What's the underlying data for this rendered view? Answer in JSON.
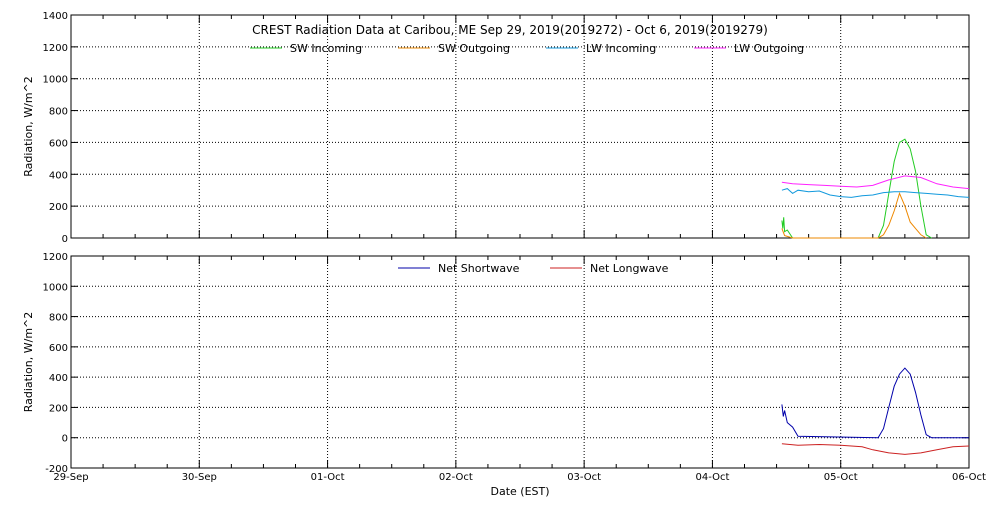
{
  "chart_data": [
    {
      "type": "line",
      "title": "CREST Radiation Data at Caribou, ME   Sep 29, 2019(2019272) - Oct  6, 2019(2019279)",
      "xlabel": "",
      "ylabel": "Radiation, W/m^2",
      "xlim": [
        "2019-09-29T00:00",
        "2019-10-06T00:00"
      ],
      "ylim": [
        0,
        1400
      ],
      "yticks": [
        0,
        200,
        400,
        600,
        800,
        1000,
        1200,
        1400
      ],
      "grid": true,
      "legend_position": "top",
      "series": [
        {
          "name": "SW Incoming",
          "color": "#22cc22",
          "points": [
            [
              "2019-10-04T13:00",
              110
            ],
            [
              "2019-10-04T13:10",
              60
            ],
            [
              "2019-10-04T13:20",
              130
            ],
            [
              "2019-10-04T13:30",
              40
            ],
            [
              "2019-10-04T14:00",
              50
            ],
            [
              "2019-10-04T15:00",
              0
            ],
            [
              "2019-10-05T07:00",
              0
            ],
            [
              "2019-10-05T08:00",
              80
            ],
            [
              "2019-10-05T09:00",
              280
            ],
            [
              "2019-10-05T10:00",
              480
            ],
            [
              "2019-10-05T11:00",
              600
            ],
            [
              "2019-10-05T12:00",
              620
            ],
            [
              "2019-10-05T13:00",
              560
            ],
            [
              "2019-10-05T14:00",
              420
            ],
            [
              "2019-10-05T15:00",
              200
            ],
            [
              "2019-10-05T16:00",
              20
            ],
            [
              "2019-10-05T17:00",
              0
            ]
          ]
        },
        {
          "name": "SW Outgoing",
          "color": "#ee8800",
          "points": [
            [
              "2019-10-04T13:00",
              60
            ],
            [
              "2019-10-04T13:30",
              15
            ],
            [
              "2019-10-04T14:00",
              10
            ],
            [
              "2019-10-04T15:00",
              0
            ],
            [
              "2019-10-05T07:00",
              0
            ],
            [
              "2019-10-05T08:00",
              20
            ],
            [
              "2019-10-05T09:00",
              80
            ],
            [
              "2019-10-05T10:00",
              170
            ],
            [
              "2019-10-05T11:00",
              280
            ],
            [
              "2019-10-05T12:00",
              200
            ],
            [
              "2019-10-05T13:00",
              100
            ],
            [
              "2019-10-05T14:00",
              60
            ],
            [
              "2019-10-05T15:00",
              20
            ],
            [
              "2019-10-05T16:00",
              0
            ]
          ]
        },
        {
          "name": "LW Incoming",
          "color": "#1199dd",
          "points": [
            [
              "2019-10-04T13:00",
              300
            ],
            [
              "2019-10-04T14:00",
              310
            ],
            [
              "2019-10-04T15:00",
              280
            ],
            [
              "2019-10-04T16:00",
              300
            ],
            [
              "2019-10-04T18:00",
              290
            ],
            [
              "2019-10-04T20:00",
              295
            ],
            [
              "2019-10-04T22:00",
              270
            ],
            [
              "2019-10-05T00:00",
              260
            ],
            [
              "2019-10-05T02:00",
              255
            ],
            [
              "2019-10-05T04:00",
              265
            ],
            [
              "2019-10-05T06:00",
              270
            ],
            [
              "2019-10-05T08:00",
              285
            ],
            [
              "2019-10-05T10:00",
              290
            ],
            [
              "2019-10-05T12:00",
              290
            ],
            [
              "2019-10-05T14:00",
              285
            ],
            [
              "2019-10-05T16:00",
              280
            ],
            [
              "2019-10-05T18:00",
              275
            ],
            [
              "2019-10-05T20:00",
              270
            ],
            [
              "2019-10-05T22:00",
              260
            ],
            [
              "2019-10-06T00:00",
              255
            ]
          ]
        },
        {
          "name": "LW Outgoing",
          "color": "#ff22ff",
          "points": [
            [
              "2019-10-04T13:00",
              350
            ],
            [
              "2019-10-04T15:00",
              340
            ],
            [
              "2019-10-04T18:00",
              335
            ],
            [
              "2019-10-04T21:00",
              330
            ],
            [
              "2019-10-05T00:00",
              325
            ],
            [
              "2019-10-05T03:00",
              320
            ],
            [
              "2019-10-05T06:00",
              330
            ],
            [
              "2019-10-05T09:00",
              365
            ],
            [
              "2019-10-05T12:00",
              390
            ],
            [
              "2019-10-05T15:00",
              380
            ],
            [
              "2019-10-05T18:00",
              340
            ],
            [
              "2019-10-05T21:00",
              320
            ],
            [
              "2019-10-06T00:00",
              310
            ]
          ]
        }
      ]
    },
    {
      "type": "line",
      "title": "",
      "xlabel": "Date (EST)",
      "ylabel": "Radiation, W/m^2",
      "xlim": [
        "2019-09-29T00:00",
        "2019-10-06T00:00"
      ],
      "ylim": [
        -200,
        1200
      ],
      "yticks": [
        -200,
        0,
        200,
        400,
        600,
        800,
        1000,
        1200
      ],
      "xticks": [
        "29-Sep",
        "30-Sep",
        "01-Oct",
        "02-Oct",
        "03-Oct",
        "04-Oct",
        "05-Oct",
        "06-Oct"
      ],
      "grid": true,
      "legend_position": "top",
      "series": [
        {
          "name": "Net Shortwave",
          "color": "#0000aa",
          "points": [
            [
              "2019-10-04T13:00",
              220
            ],
            [
              "2019-10-04T13:15",
              140
            ],
            [
              "2019-10-04T13:30",
              180
            ],
            [
              "2019-10-04T14:00",
              100
            ],
            [
              "2019-10-04T15:00",
              70
            ],
            [
              "2019-10-04T16:00",
              10
            ],
            [
              "2019-10-05T07:00",
              0
            ],
            [
              "2019-10-05T08:00",
              60
            ],
            [
              "2019-10-05T09:00",
              200
            ],
            [
              "2019-10-05T10:00",
              340
            ],
            [
              "2019-10-05T11:00",
              420
            ],
            [
              "2019-10-05T12:00",
              460
            ],
            [
              "2019-10-05T13:00",
              420
            ],
            [
              "2019-10-05T14:00",
              300
            ],
            [
              "2019-10-05T15:00",
              150
            ],
            [
              "2019-10-05T16:00",
              20
            ],
            [
              "2019-10-05T17:00",
              0
            ],
            [
              "2019-10-06T00:00",
              0
            ]
          ]
        },
        {
          "name": "Net Longwave",
          "color": "#cc2222",
          "points": [
            [
              "2019-10-04T13:00",
              -40
            ],
            [
              "2019-10-04T16:00",
              -50
            ],
            [
              "2019-10-04T20:00",
              -45
            ],
            [
              "2019-10-05T00:00",
              -50
            ],
            [
              "2019-10-05T04:00",
              -60
            ],
            [
              "2019-10-05T06:00",
              -80
            ],
            [
              "2019-10-05T09:00",
              -100
            ],
            [
              "2019-10-05T12:00",
              -110
            ],
            [
              "2019-10-05T15:00",
              -100
            ],
            [
              "2019-10-05T18:00",
              -80
            ],
            [
              "2019-10-05T21:00",
              -60
            ],
            [
              "2019-10-06T00:00",
              -55
            ]
          ]
        }
      ]
    }
  ]
}
